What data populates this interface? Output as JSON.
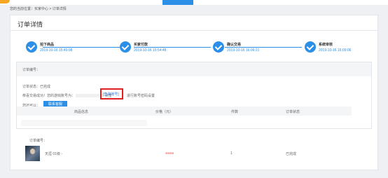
{
  "nav": {
    "items": [
      "",
      "",
      "",
      "",
      ""
    ],
    "active_index": 1
  },
  "breadcrumb": "您的当前位置：买家中心 > 订单详情",
  "page_title": "订单详情",
  "steps": [
    {
      "title": "拍下商品",
      "time": "2019-10-16 15:49:08"
    },
    {
      "title": "买家付款",
      "time": "2019-10-16 15:54:48"
    },
    {
      "title": "确认交易",
      "time": "2019-10-16 16:06:21"
    },
    {
      "title": "系统审核",
      "time": "2019-10-16 16:09:06"
    }
  ],
  "info": {
    "order_no_label": "订单编号：",
    "status_line": "订单状态：已完成",
    "success_prefix": "恭喜交易成功！您的游戏账号为：",
    "success_mid": "点击",
    "view_account_link": "[查询账号]",
    "success_suffix": "进行账号密码设置",
    "contact_prefix": "您还可以：",
    "contact_button": "联系客服"
  },
  "table": {
    "headers": [
      "商品信息",
      "价格（元）",
      "件数",
      "订单状态"
    ],
    "order_no_label": "订单编号：",
    "row": {
      "name": "天涯 01级 -",
      "quantity": "1",
      "status": "已完成"
    }
  },
  "colors": {
    "accent": "#2b8fe8",
    "highlight_border": "#e02020"
  }
}
